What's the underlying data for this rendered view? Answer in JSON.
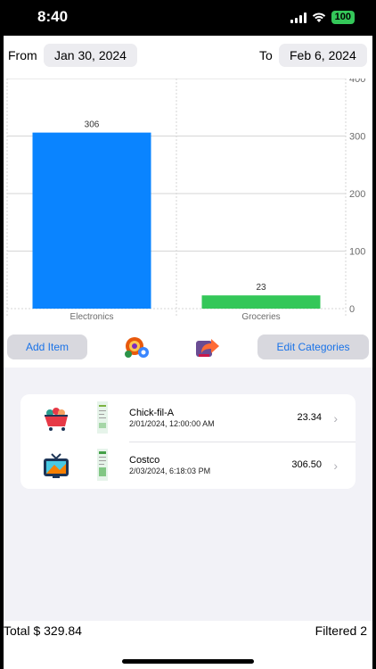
{
  "status": {
    "time": "8:40",
    "battery": "100"
  },
  "filters": {
    "from_label": "From",
    "from_date": "Jan 30, 2024",
    "to_label": "To",
    "to_date": "Feb 6, 2024"
  },
  "chart_data": {
    "type": "bar",
    "categories": [
      "Electronics",
      "Groceries"
    ],
    "values": [
      306,
      23
    ],
    "data_labels": [
      "306",
      "23"
    ],
    "colors": [
      "#0a84ff",
      "#34c759"
    ],
    "ylim": [
      0,
      400
    ],
    "yticks": [
      "0",
      "100",
      "200",
      "300",
      "400"
    ],
    "grid": true,
    "y_axis_side": "right"
  },
  "actions": {
    "add_item": "Add Item",
    "edit_categories": "Edit Categories",
    "settings_icon": "gears-icon",
    "export_icon": "export-icon"
  },
  "transactions": [
    {
      "name": "Chick-fil-A",
      "date": "2/01/2024, 12:00:00 AM",
      "amount": "23.34",
      "category_icon": "shopping-cart-icon"
    },
    {
      "name": "Costco",
      "date": "2/03/2024, 6:18:03 PM",
      "amount": "306.50",
      "category_icon": "tv-icon"
    }
  ],
  "footer": {
    "total": "Total $ 329.84",
    "filtered": "Filtered 2"
  }
}
